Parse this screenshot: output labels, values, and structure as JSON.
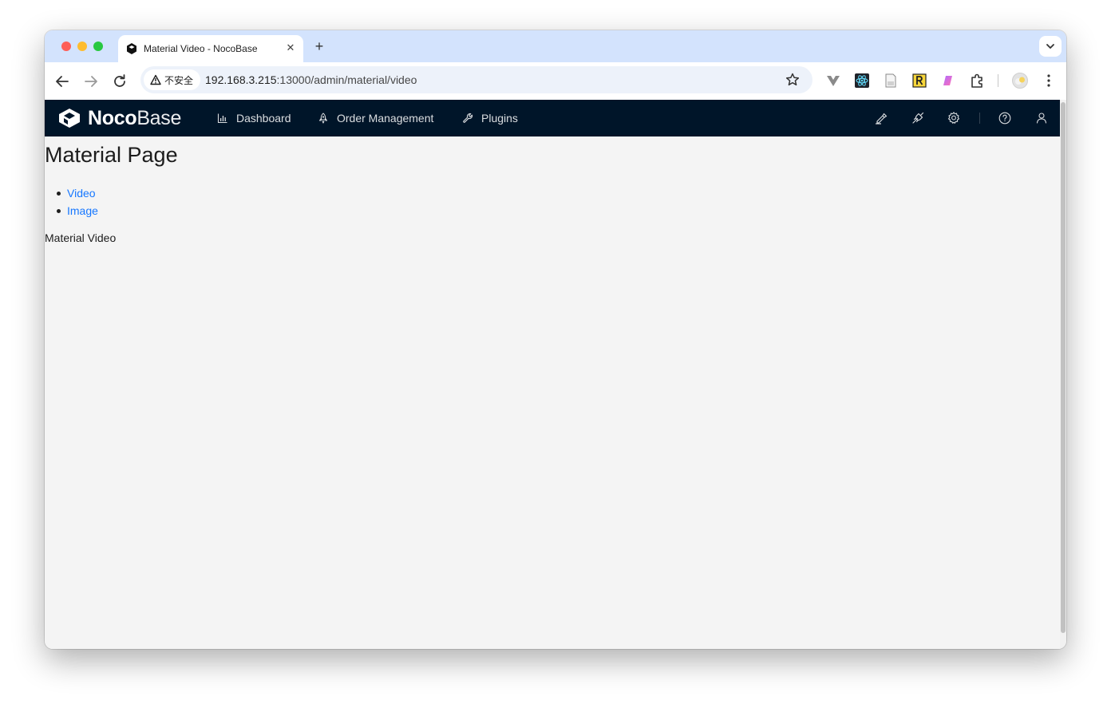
{
  "browser": {
    "tab_title": "Material Video - NocoBase",
    "tab_close": "✕",
    "new_tab": "+",
    "security_label": "不安全",
    "url_host": "192.168.3.215",
    "url_path": ":13000/admin/material/video"
  },
  "app": {
    "logo_bold": "Noco",
    "logo_light": "Base",
    "menu": [
      {
        "label": "Dashboard",
        "icon": "bar-chart-icon"
      },
      {
        "label": "Order Management",
        "icon": "rocket-icon"
      },
      {
        "label": "Plugins",
        "icon": "wrench-icon"
      }
    ],
    "header_icons": [
      "highlight-icon",
      "api-icon",
      "settings-icon",
      "help-icon",
      "user-icon"
    ],
    "colors": {
      "header_bg": "#001529",
      "link": "#1677ff",
      "page_bg": "#f4f4f4"
    }
  },
  "page": {
    "title": "Material Page",
    "links": [
      "Video",
      "Image"
    ],
    "route_text": "Material Video"
  }
}
